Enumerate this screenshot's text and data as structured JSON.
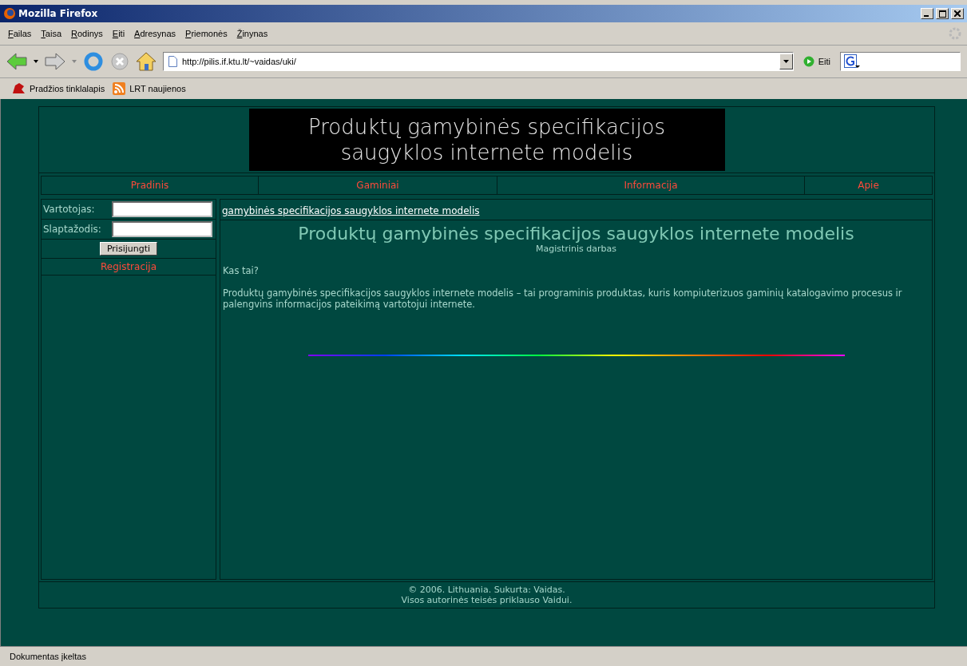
{
  "window": {
    "title": "Mozilla Firefox"
  },
  "menu": [
    "Failas",
    "Taisa",
    "Rodinys",
    "Eiti",
    "Adresynas",
    "Priemonės",
    "Žinynas"
  ],
  "address": {
    "value": "http://pilis.if.ktu.lt/~vaidas/uki/"
  },
  "go_button": "Eiti",
  "bookmarks": [
    {
      "label": "Pradžios tinklalapis",
      "kind": "home"
    },
    {
      "label": "LRT naujienos",
      "kind": "feed"
    }
  ],
  "page": {
    "banner": [
      "Produktų gamybinės specifikacijos",
      "saugyklos internete modelis"
    ],
    "nav": [
      "Pradinis",
      "Gaminiai",
      "Informacija",
      "Apie"
    ],
    "login": {
      "user_label": "Vartotojas:",
      "password_label": "Slaptažodis:",
      "button": "Prisijungti",
      "register": "Registracija"
    },
    "breadcrumb": "gamybinės specifikacijos saugyklos internete modelis",
    "heading": "Produktų gamybinės specifikacijos saugyklos internete modelis",
    "subheading": "Magistrinis darbas",
    "question": "Kas tai?",
    "paragraph": "Produktų gamybinės specifikacijos saugyklos internete modelis – tai programinis produktas, kuris kompiuterizuos gaminių katalogavimo procesus ir palengvins informacijos pateikimą vartotojui internete.",
    "footer": [
      "© 2006. Lithuania. Sukurta: Vaidas.",
      "Visos autorinės teisės priklauso Vaidui."
    ]
  },
  "status_bar": "Dokumentas įkeltas"
}
